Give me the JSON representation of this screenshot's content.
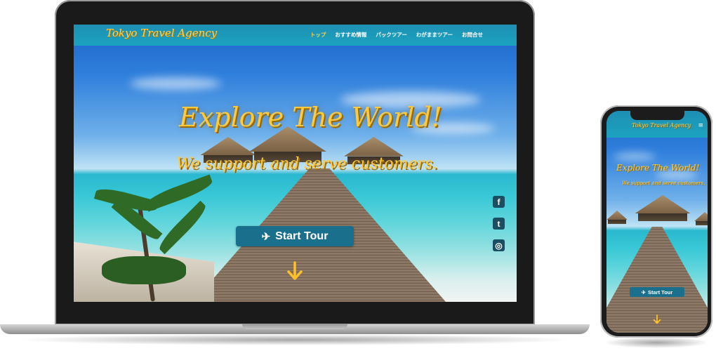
{
  "site": {
    "logo": "Tokyo Travel Agency",
    "nav": [
      {
        "label": "トップ",
        "active": true
      },
      {
        "label": "おすすめ情報",
        "active": false
      },
      {
        "label": "パックツアー",
        "active": false
      },
      {
        "label": "わがままツアー",
        "active": false
      },
      {
        "label": "お問合せ",
        "active": false
      }
    ],
    "hero_title": "Explore The World!",
    "hero_subtitle": "We support and serve customers.",
    "start_button": "Start Tour",
    "plane_glyph": "✈",
    "social": [
      {
        "name": "facebook-icon",
        "glyph": "f"
      },
      {
        "name": "twitter-icon",
        "glyph": "t"
      },
      {
        "name": "instagram-icon",
        "glyph": "◎"
      }
    ]
  },
  "phone": {
    "menu_glyph": "≡"
  },
  "colors": {
    "header": "#1ba3bf",
    "accent_gold": "#ffc93c",
    "button": "#1a6f8c"
  }
}
